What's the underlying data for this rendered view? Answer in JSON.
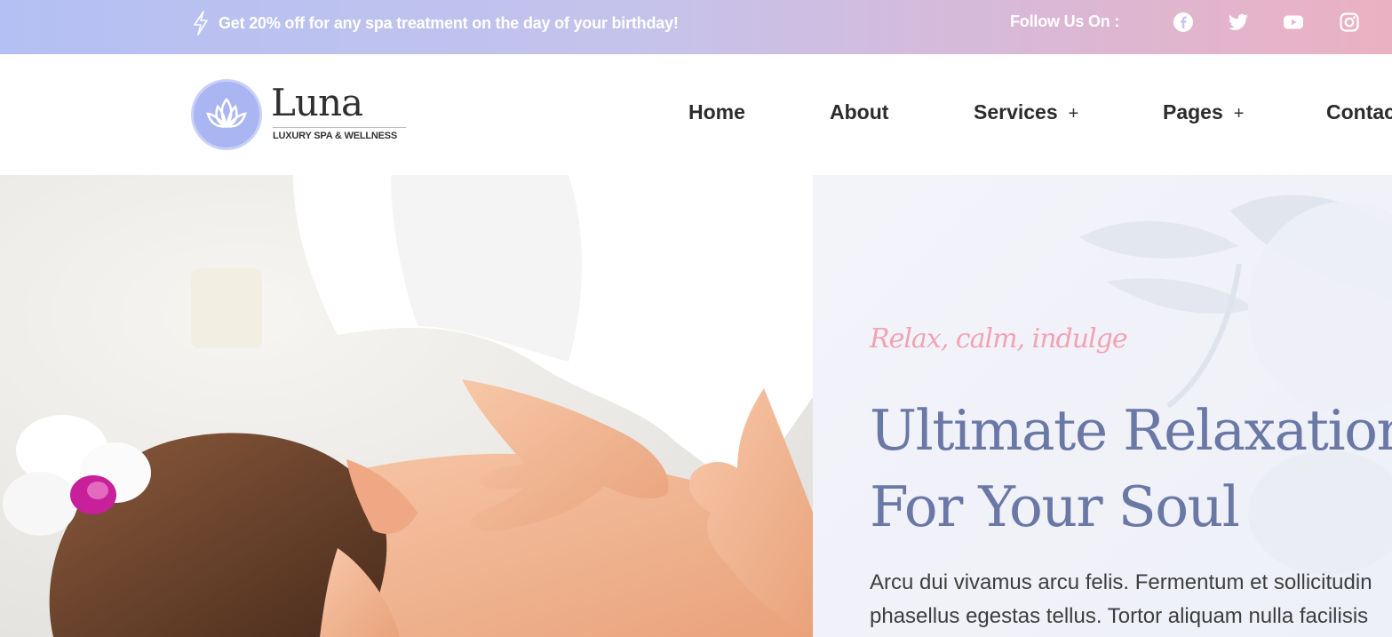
{
  "topbar": {
    "promo_icon": "lightning-bolt-icon",
    "promo_text": "Get 20% off for any spa treatment on the day of your birthday!",
    "follow_label": "Follow Us On :",
    "social": [
      "facebook-icon",
      "twitter-icon",
      "youtube-icon",
      "instagram-icon"
    ]
  },
  "logo": {
    "name": "Luna",
    "tagline": "LUXURY SPA & WELLNESS",
    "icon": "lotus-icon"
  },
  "nav": {
    "items": [
      {
        "label": "Home",
        "submenu": false
      },
      {
        "label": "About",
        "submenu": false
      },
      {
        "label": "Services",
        "submenu": true
      },
      {
        "label": "Pages",
        "submenu": true
      },
      {
        "label": "Contac",
        "submenu": false
      }
    ],
    "submenu_symbol": "+"
  },
  "hero": {
    "image": "spa-massage-photo",
    "subtitle": "Relax, calm, indulge",
    "title_line1": "Ultimate Relaxation",
    "title_line2": "For Your Soul",
    "desc_line1": "Arcu dui vivamus arcu felis. Fermentum et sollicitudin",
    "desc_line2": "phasellus egestas tellus. Tortor aliquam nulla facilisis"
  },
  "colors": {
    "topbar_gradient_start": "#b4c0f3",
    "topbar_gradient_end": "#ebb1c2",
    "accent_blue": "#6a78a6",
    "accent_pink": "#f2a2b3",
    "logo_circle": "#a9b6f2"
  }
}
